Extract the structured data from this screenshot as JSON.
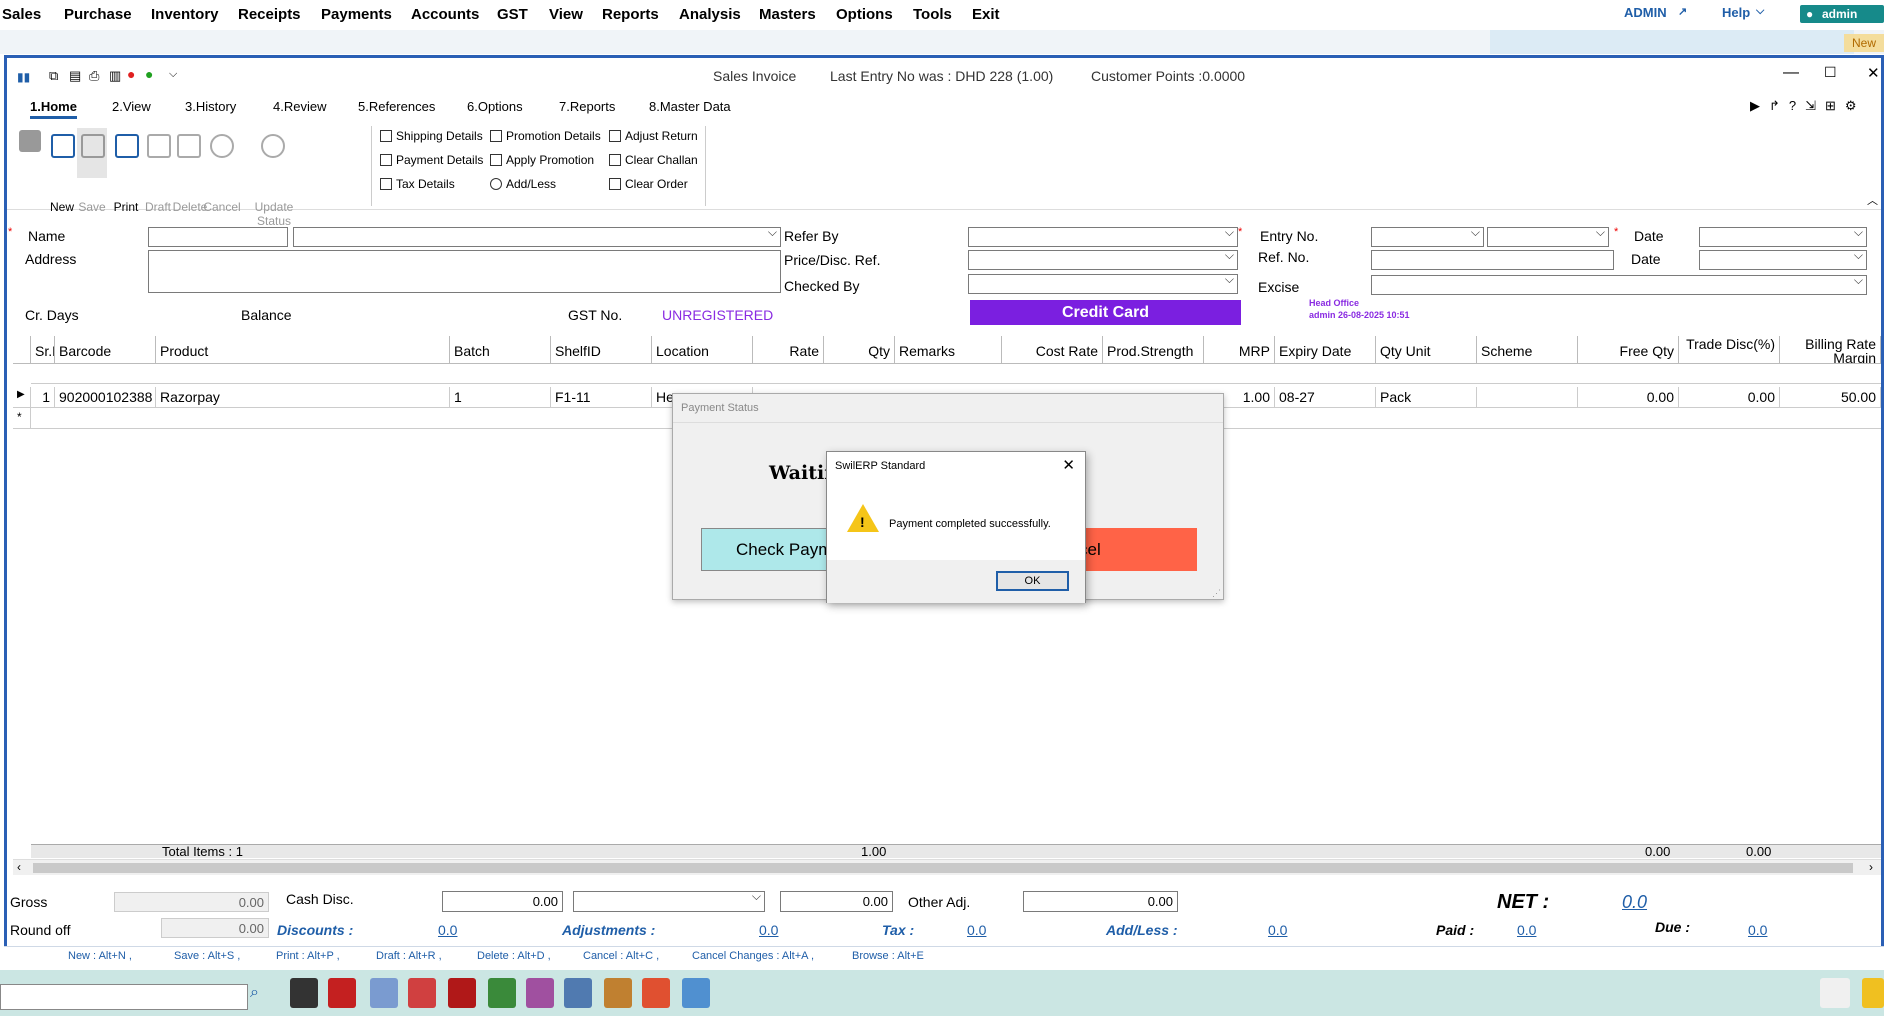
{
  "menu": [
    "Sales",
    "Purchase",
    "Inventory",
    "Receipts",
    "Payments",
    "Accounts",
    "GST",
    "View",
    "Reports",
    "Analysis",
    "Masters",
    "Options",
    "Tools",
    "Exit"
  ],
  "topright": {
    "admin_link": "ADMIN",
    "help": "Help",
    "user": "admin",
    "new_tag": "New"
  },
  "window": {
    "title": "Sales Invoice",
    "last_entry": "Last Entry No was : DHD 228 (1.00)",
    "customer_points": "Customer Points :0.0000"
  },
  "tabs": [
    "1.Home",
    "2.View",
    "3.History",
    "4.Review",
    "5.References",
    "6.Options",
    "7.Reports",
    "8.Master Data"
  ],
  "ribbon": {
    "buttons": [
      "New",
      "Save",
      "Print",
      "Draft",
      "Delete",
      "Cancel",
      "Update Status"
    ],
    "links": [
      "Shipping Details",
      "Payment Details",
      "Tax Details",
      "Promotion Details",
      "Apply Promotion",
      "Add/Less",
      "Adjust Return",
      "Clear Challan",
      "Clear Order"
    ]
  },
  "form": {
    "name_label": "Name",
    "address_label": "Address",
    "crdays_label": "Cr. Days",
    "balance_label": "Balance",
    "gst_label": "GST No.",
    "gst_value": "UNREGISTERED",
    "refer_by": "Refer By",
    "price_ref": "Price/Disc. Ref.",
    "checked_by": "Checked By",
    "payment_mode": "Credit Card",
    "entry_no": "Entry No.",
    "ref_no": "Ref. No.",
    "excise": "Excise",
    "date1": "Date",
    "date2": "Date",
    "office": "Head Office",
    "office_meta": "admin 26-08-2025 10:51"
  },
  "grid": {
    "headers": [
      "Sr.N",
      "Barcode",
      "Product",
      "Batch",
      "ShelfID",
      "Location",
      "Rate",
      "Qty",
      "Remarks",
      "Cost Rate",
      "Prod.Strength",
      "MRP",
      "Expiry Date",
      "Qty Unit",
      "Scheme",
      "Free Qty",
      "Trade Disc(%)",
      "Billing Rate Margin"
    ],
    "row": {
      "sr": "1",
      "barcode": "902000102388",
      "product": "Razorpay",
      "batch": "1",
      "shelf": "F1-11",
      "location": "He",
      "mrp": "1.00",
      "expiry": "08-27",
      "unit": "Pack",
      "free_qty": "0.00",
      "trade": "0.00",
      "margin": "50.00"
    },
    "totals": {
      "items": "Total Items : 1",
      "qty": "1.00",
      "free": "0.00",
      "trade": "0.00"
    }
  },
  "payment_dialog": {
    "title": "Payment Status",
    "waiting": "Waitin",
    "check": "Check Paym",
    "cancel": "cel"
  },
  "msgbox": {
    "title": "SwilERP Standard",
    "message": "Payment completed successfully.",
    "ok": "OK"
  },
  "footer": {
    "gross_label": "Gross",
    "gross": "0.00",
    "roundoff_label": "Round off",
    "roundoff": "0.00",
    "cashdisc_label": "Cash Disc.",
    "cashdisc": "0.00",
    "cashdisc2": "0.00",
    "otheradj_label": "Other Adj.",
    "otheradj": "0.00",
    "net_label": "NET :",
    "net": "0.0",
    "discounts": "Discounts :",
    "discounts_v": "0.0",
    "adjustments": "Adjustments :",
    "adjustments_v": "0.0",
    "tax": "Tax :",
    "tax_v": "0.0",
    "addless": "Add/Less :",
    "addless_v": "0.0",
    "paid": "Paid :",
    "paid_v": "0.0",
    "due": "Due :",
    "due_v": "0.0"
  },
  "shortcuts": [
    "New : Alt+N ,",
    "Save : Alt+S ,",
    "Print : Alt+P ,",
    "Draft : Alt+R ,",
    "Delete : Alt+D ,",
    "Cancel : Alt+C ,",
    "Cancel Changes : Alt+A ,",
    "Browse : Alt+E"
  ],
  "colors": {
    "accent": "#1f5ea8",
    "credit_card": "#7b1fe0",
    "cancel_btn": "#ff6347",
    "check_btn": "#aee8ea",
    "gst": "#8a2be2"
  }
}
